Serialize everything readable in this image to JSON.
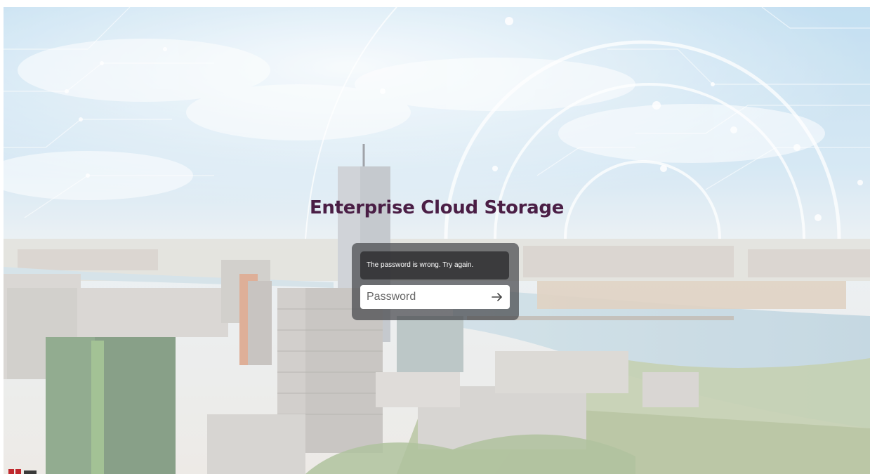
{
  "app": {
    "title": "Enterprise Cloud Storage"
  },
  "login": {
    "error_message": "The password is wrong. Try again.",
    "password_placeholder": "Password",
    "password_value": "",
    "submit_icon": "arrow-right-icon"
  },
  "colors": {
    "title": "#4a1e45",
    "panel": "#46484c",
    "error_box": "#2d2d30",
    "brand_red": "#c0282d"
  }
}
